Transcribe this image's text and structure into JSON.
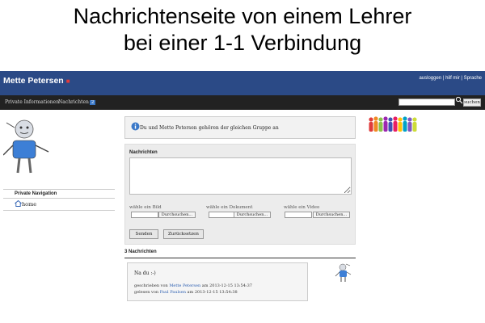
{
  "caption": {
    "line1": "Nachrichtenseite von einem Lehrer",
    "line2": "bei einer 1-1 Verbindung"
  },
  "header": {
    "user_name": "Mette Petersen",
    "links": [
      "ausloggen",
      "hilf mir",
      "Sprache"
    ]
  },
  "nav": {
    "tabs": [
      "Private Informationen",
      "Nachrichten"
    ],
    "badge": "2",
    "search_placeholder": "",
    "search_button": "suchen"
  },
  "sidebar": {
    "heading": "Private Navigation",
    "items": [
      {
        "label": "home",
        "icon": "home-icon"
      }
    ]
  },
  "info": {
    "text": "Du und Mette Petersen gehören der gleichen Gruppe an"
  },
  "form": {
    "label": "Nachrichten",
    "file_fields": [
      {
        "label": "wähle ein Bild",
        "button": "Durchsuchen..."
      },
      {
        "label": "wähle ein Dokument",
        "button": "Durchsuchen..."
      },
      {
        "label": "wähle ein Video",
        "button": "Durchsuchen..."
      }
    ],
    "send_button": "Senden",
    "reset_button": "Zurücksetzen"
  },
  "messages": {
    "count_label": "3 Nachrichten",
    "items": [
      {
        "body": "Na du :-)",
        "written_prefix": "geschrieben von",
        "written_by": "Mette Petersen",
        "written_at": "am 2013-12-15 13:54:37",
        "read_prefix": "gelesen von",
        "read_by": "Paul Paulsen",
        "read_at": "am 2013-12-15 13:54:38"
      }
    ]
  },
  "colors": {
    "header": "#2b4a86",
    "navbar": "#222222",
    "badge": "#3a78c8",
    "link": "#2a5db0"
  }
}
